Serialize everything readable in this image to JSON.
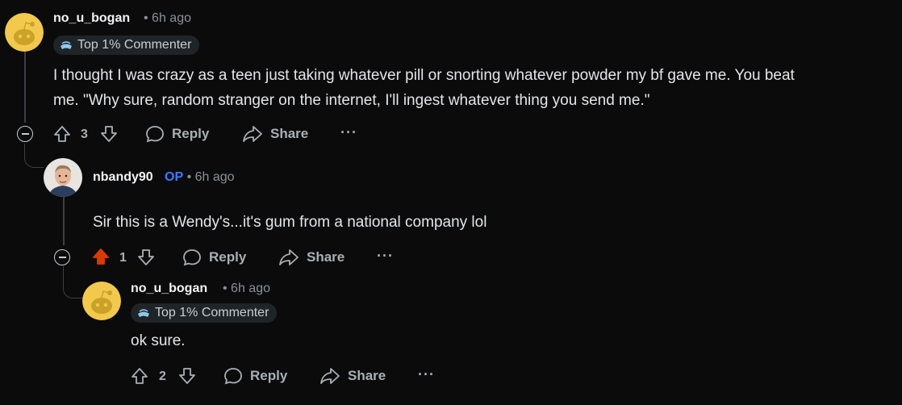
{
  "comments": [
    {
      "username": "no_u_bogan",
      "time": "6h ago",
      "flair": "Top 1% Commenter",
      "body_line1": "I thought I was crazy as a teen just taking whatever pill or snorting whatever powder my bf gave me. You beat",
      "body_line2": "me. \"Why sure, random stranger on the internet, I'll ingest whatever thing you send me.\"",
      "votes": "3",
      "reply_label": "Reply",
      "share_label": "Share"
    },
    {
      "username": "nbandy90",
      "op_badge": "OP",
      "time": "6h ago",
      "body_line1": "Sir this is a Wendy's...it's gum from a national company lol",
      "votes": "1",
      "upvoted": true,
      "reply_label": "Reply",
      "share_label": "Share"
    },
    {
      "username": "no_u_bogan",
      "time": "6h ago",
      "flair": "Top 1% Commenter",
      "body_line1": "ok sure.",
      "votes": "2",
      "reply_label": "Reply",
      "share_label": "Share"
    }
  ],
  "colors": {
    "background": "#0b0b0c",
    "upvote_active": "#d93a00",
    "op_badge": "#3a7bff",
    "avatar_yellow": "#f2c94c"
  }
}
